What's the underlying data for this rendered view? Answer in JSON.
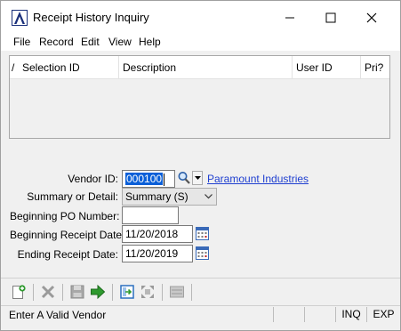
{
  "window": {
    "title": "Receipt History Inquiry"
  },
  "menu": {
    "items": [
      "File",
      "Record",
      "Edit",
      "View",
      "Help"
    ]
  },
  "grid": {
    "mark_header": "/",
    "columns": [
      "Selection ID",
      "Description",
      "User ID",
      "Pri?"
    ],
    "rows": []
  },
  "form": {
    "vendor_label": "Vendor ID:",
    "vendor_value": "000100",
    "vendor_name": "Paramount Industries",
    "summary_label": "Summary or Detail:",
    "summary_value": "Summary (S)",
    "po_label": "Beginning PO Number:",
    "po_value": "",
    "begin_date_label": "Beginning Receipt Date:",
    "begin_date_value": "11/20/2018",
    "end_date_label": "Ending Receipt Date:",
    "end_date_value": "11/20/2019"
  },
  "toolbar": {
    "icons": [
      "new-record-icon",
      "delete-icon",
      "save-icon",
      "go-arrow-icon",
      "import-icon",
      "expand-icon",
      "list-icon"
    ]
  },
  "status": {
    "message": "Enter A Valid Vendor",
    "cells": [
      "",
      "",
      "",
      "INQ",
      "EXP"
    ]
  },
  "colors": {
    "selection": "#0a5fd8",
    "link": "#1f3fd0",
    "toolbar_green": "#2e9a2e",
    "toolbar_blue": "#2a6fbf"
  }
}
